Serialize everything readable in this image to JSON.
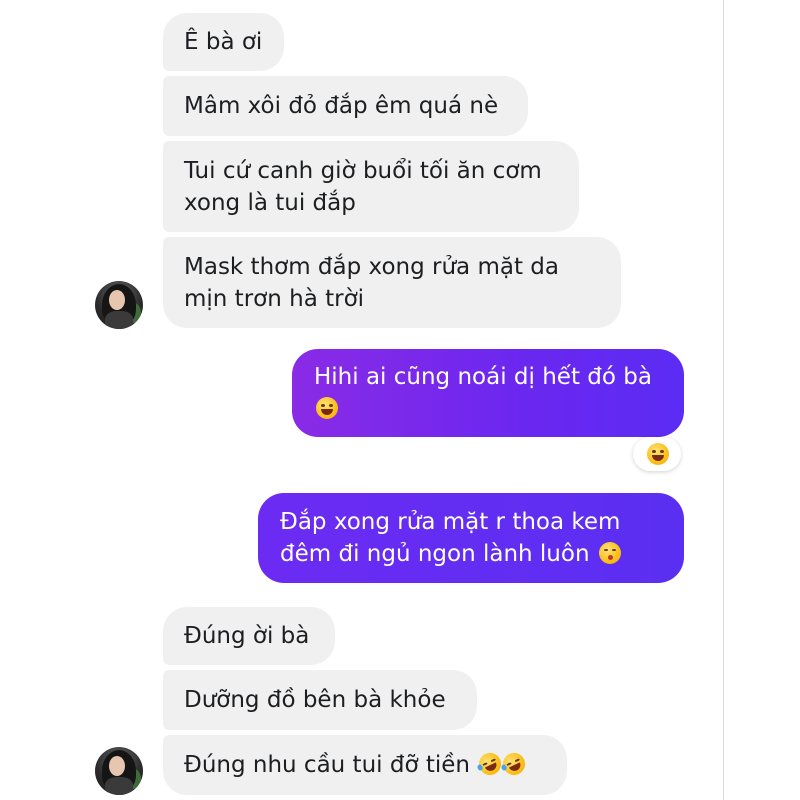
{
  "messages": {
    "m1": {
      "line1": "Ê bà ơi"
    },
    "m2": {
      "line1": "Mâm xôi đỏ đắp êm quá nè"
    },
    "m3": {
      "line1": "Tui cứ canh giờ buổi tối ăn cơm",
      "line2": "xong là tui đắp"
    },
    "m4": {
      "line1": "Mask thơm đắp xong rửa mặt da",
      "line2": "mịn trơn hà trời"
    },
    "m5": {
      "line1": "Hihi ai cũng noái dị hết đó bà",
      "emoji": "laughing-emoji"
    },
    "m6": {
      "line1": "Đắp xong rửa mặt r thoa kem",
      "line2": "đêm đi ngủ ngon lành luôn",
      "emoji": "kissing-emoji"
    },
    "m7": {
      "line1": "Đúng ời bà"
    },
    "m8": {
      "line1": "Dưỡng đồ bên bà khỏe"
    },
    "m9": {
      "line1": "Đúng nhu cầu tui đỡ tiền",
      "emoji": "rofl-emoji"
    }
  },
  "reaction": {
    "emoji": "laughing-emoji"
  },
  "colors": {
    "incoming_bubble": "#f0f0f0",
    "outgoing_gradient_start": "#8a2be6",
    "outgoing_gradient_end": "#5b2cf4",
    "text_dark": "#1c1e21",
    "text_light": "#ffffff"
  }
}
